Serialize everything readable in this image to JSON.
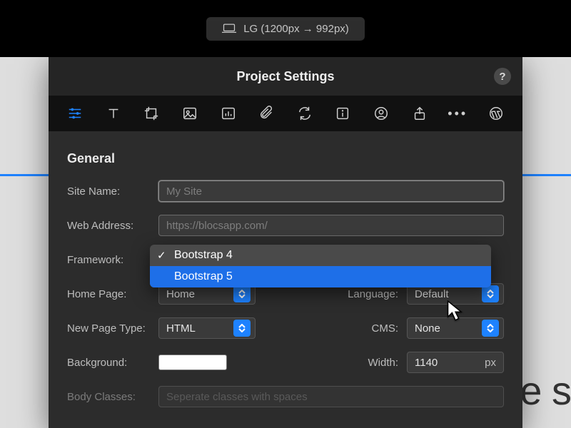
{
  "topbar": {
    "breakpoint_label": "LG (1200px → 992px)"
  },
  "panel": {
    "title": "Project Settings",
    "help": "?",
    "tabs": [
      "settings",
      "typography",
      "frame",
      "image",
      "chart",
      "attachment",
      "sync",
      "info",
      "user",
      "share",
      "more",
      "wordpress"
    ]
  },
  "section": {
    "general": "General"
  },
  "fields": {
    "site_name": {
      "label": "Site Name:",
      "placeholder": "My Site",
      "value": ""
    },
    "web_address": {
      "label": "Web Address:",
      "placeholder": "https://blocsapp.com/",
      "value": ""
    },
    "framework": {
      "label": "Framework:",
      "options": [
        "Bootstrap 4",
        "Bootstrap 5"
      ],
      "selected": "Bootstrap 4",
      "highlighted": "Bootstrap 5"
    },
    "home_page": {
      "label": "Home Page:",
      "value": "Home"
    },
    "language": {
      "label": "Language:",
      "value": "Default"
    },
    "new_page_type": {
      "label": "New Page Type:",
      "value": "HTML"
    },
    "cms": {
      "label": "CMS:",
      "value": "None"
    },
    "background": {
      "label": "Background:",
      "value": "#FFFFFF"
    },
    "width": {
      "label": "Width:",
      "value": "1140",
      "unit": "px"
    },
    "body_classes": {
      "label": "Body Classes:",
      "placeholder": "Seperate classes with spaces"
    }
  },
  "canvas_ghost": "ve s"
}
